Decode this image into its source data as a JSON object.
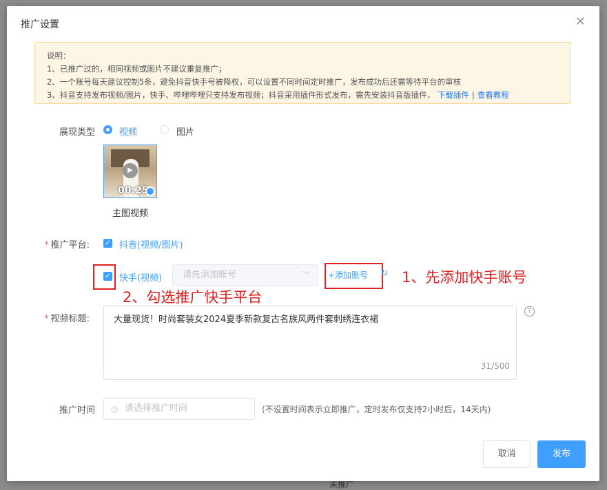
{
  "dialog": {
    "title": "推广设置",
    "close_icon": "close-icon"
  },
  "notice": {
    "heading": "说明：",
    "line1": "1、已推广过的，相同视频或图片不建议重复推广；",
    "line2": "2、一个账号每天建议控制5条，避免抖音快手号被降权，可以设置不同时间定时推广，发布成功后还需等待平台的审核",
    "line3": "3、抖音支持发布视频/图片，快手、哔哩哔哩只支持发布视频；抖音采用插件形式发布，需先安装抖音版插件，",
    "download_link": "下载插件",
    "separator": "|",
    "tutorial_link": "查看教程"
  },
  "display_type": {
    "label": "展现类型",
    "options": [
      {
        "label": "视频",
        "selected": true
      },
      {
        "label": "图片",
        "selected": false
      }
    ]
  },
  "media": {
    "duration": "00:25",
    "caption": "主图视频"
  },
  "platform": {
    "label": "推广平台:",
    "douyin": {
      "label": "抖音(视频/图片)",
      "checked": true
    },
    "kuaishou": {
      "label": "快手(视频)",
      "checked": true
    },
    "account_select_placeholder": "请先添加账号",
    "add_account": "+添加账号"
  },
  "annotations": {
    "step1": "1、先添加快手账号",
    "step2": "2、勾选推广快手平台"
  },
  "video_title": {
    "label": "视频标题:",
    "value": "大量现货！时尚套装女2024夏季新款复古名族风两件套刺绣连衣裙",
    "counter": "31/500"
  },
  "promo_time": {
    "label": "推广时间",
    "placeholder": "请选择推广时间",
    "hint": "(不设置时间表示立即推广，定时发布仅支持2小时后，14天内)"
  },
  "buttons": {
    "cancel": "取消",
    "publish": "发布"
  },
  "backdrop": {
    "bottom_text": "未推广"
  },
  "colors": {
    "primary": "#409eff",
    "annotation_red": "#e02020",
    "notice_bg": "#fdf6e4"
  }
}
